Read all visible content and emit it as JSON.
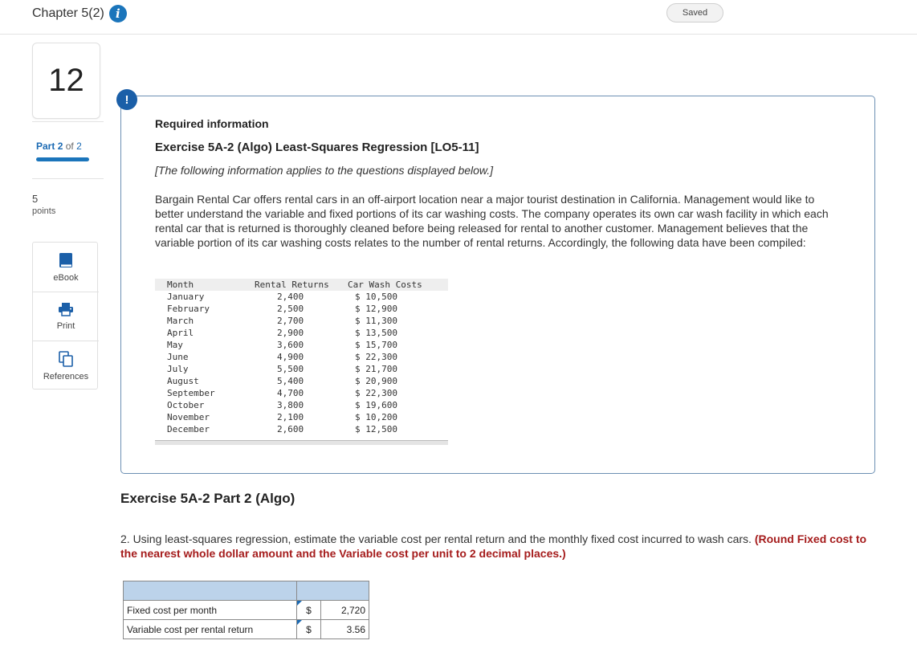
{
  "header": {
    "chapter_title": "Chapter 5(2)",
    "saved_label": "Saved"
  },
  "rail": {
    "question_number": "12",
    "part_label": "Part",
    "part_current": "2",
    "part_of": "of",
    "part_total": "2",
    "points_value": "5",
    "points_label": "points",
    "tools": [
      {
        "label": "eBook",
        "icon": "book-icon"
      },
      {
        "label": "Print",
        "icon": "printer-icon"
      },
      {
        "label": "References",
        "icon": "copy-icon"
      }
    ]
  },
  "info": {
    "badge": "!",
    "required_info": "Required information",
    "exercise_title": "Exercise 5A-2 (Algo) Least-Squares Regression [LO5-11]",
    "applies_note": "[The following information applies to the questions displayed below.]",
    "scenario": "Bargain Rental Car offers rental cars in an off-airport location near a major tourist destination in California. Management would like to better understand the variable and fixed portions of its car washing costs. The company operates its own car wash facility in which each rental car that is returned is thoroughly cleaned before being released for rental to another customer. Management believes that the variable portion of its car washing costs relates to the number of rental returns. Accordingly, the following data have been compiled:",
    "table": {
      "headers": [
        "Month",
        "Rental Returns",
        "Car Wash Costs"
      ],
      "rows": [
        [
          "January",
          "2,400",
          "$ 10,500"
        ],
        [
          "February",
          "2,500",
          "$ 12,900"
        ],
        [
          "March",
          "2,700",
          "$ 11,300"
        ],
        [
          "April",
          "2,900",
          "$ 13,500"
        ],
        [
          "May",
          "3,600",
          "$ 15,700"
        ],
        [
          "June",
          "4,900",
          "$ 22,300"
        ],
        [
          "July",
          "5,500",
          "$ 21,700"
        ],
        [
          "August",
          "5,400",
          "$ 20,900"
        ],
        [
          "September",
          "4,700",
          "$ 22,300"
        ],
        [
          "October",
          "3,800",
          "$ 19,600"
        ],
        [
          "November",
          "2,100",
          "$ 10,200"
        ],
        [
          "December",
          "2,600",
          "$ 12,500"
        ]
      ]
    }
  },
  "part": {
    "heading": "Exercise 5A-2 Part 2 (Algo)",
    "question": "2. Using least-squares regression, estimate the variable cost per rental return and the monthly fixed cost incurred to wash cars.",
    "round_note": "(Round Fixed cost to the nearest whole dollar amount and the Variable cost per unit to 2 decimal places.)",
    "answers": [
      {
        "label": "Fixed cost per month",
        "currency": "$",
        "value": "2,720"
      },
      {
        "label": "Variable cost per rental return",
        "currency": "$",
        "value": "3.56"
      }
    ]
  },
  "colors": {
    "accent": "#1b75bb",
    "round_note": "#a51c1c",
    "answer_header": "#bcd3ea"
  }
}
